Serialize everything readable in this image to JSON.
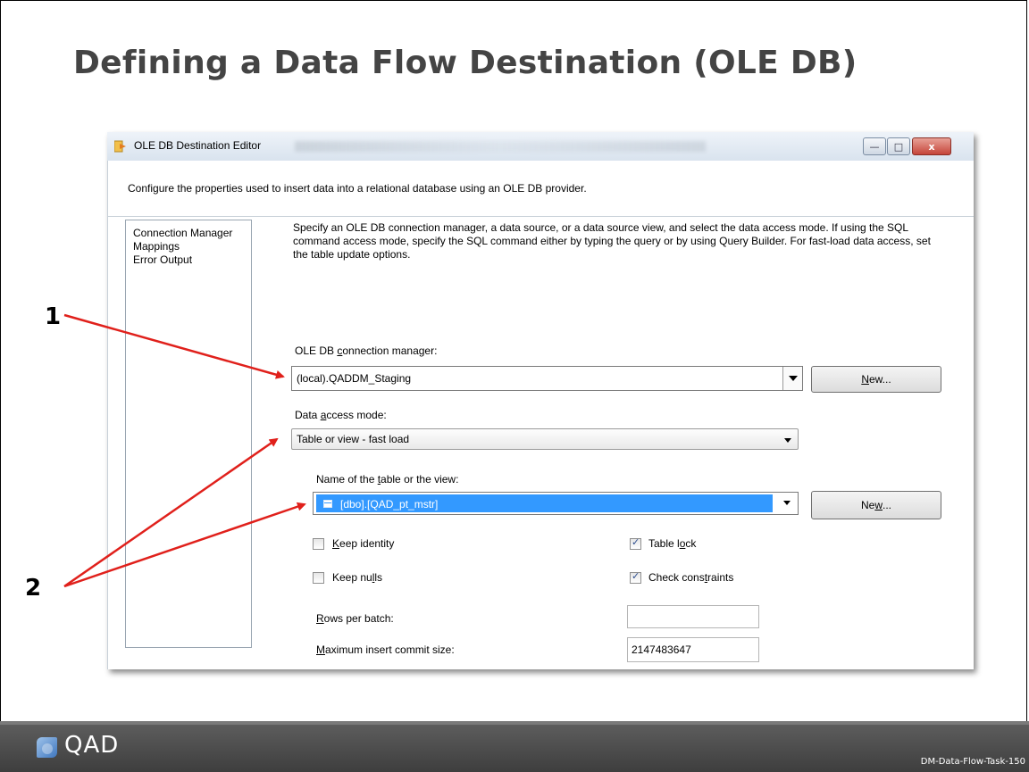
{
  "slide": {
    "title": "Defining a Data Flow Destination (OLE DB)",
    "callout_1": "1",
    "callout_2": "2",
    "footer_logo": "QAD",
    "footer_code": "DM-Data-Flow-Task-150"
  },
  "window": {
    "title": "OLE DB Destination Editor",
    "minimize_glyph": "—",
    "maximize_glyph": "□",
    "close_glyph": "x",
    "header_description": "Configure the properties used to insert data into a relational database using an OLE DB provider."
  },
  "sidebar": {
    "items": [
      {
        "label": "Connection Manager"
      },
      {
        "label": "Mappings"
      },
      {
        "label": "Error Output"
      }
    ]
  },
  "main": {
    "description": "Specify an OLE DB connection manager, a data source, or a data source view, and select the data access mode. If using the SQL command access mode, specify the SQL command either by typing the query or by using Query Builder. For fast-load data access, set the table update options.",
    "connection_manager": {
      "label_pre": "OLE DB ",
      "label_key": "c",
      "label_post": "onnection manager:",
      "value": "(local).QADDM_Staging",
      "new_pre": "",
      "new_key": "N",
      "new_post": "ew..."
    },
    "data_access_mode": {
      "label_pre": "Data ",
      "label_key": "a",
      "label_post": "ccess mode:",
      "value": "Table or view - fast load"
    },
    "table_name": {
      "label_pre": "Name of the ",
      "label_key": "t",
      "label_post": "able or the view:",
      "value": "[dbo].[QAD_pt_mstr]",
      "new_pre": "Ne",
      "new_key": "w",
      "new_post": "..."
    },
    "options": {
      "keep_identity": {
        "pre": "",
        "key": "K",
        "post": "eep identity",
        "checked": false
      },
      "keep_nulls": {
        "pre": "Keep nu",
        "key": "l",
        "post": "ls",
        "checked": false
      },
      "table_lock": {
        "pre": "Table l",
        "key": "o",
        "post": "ck",
        "checked": true
      },
      "check_constraints": {
        "pre": "Check cons",
        "key": "t",
        "post": "raints",
        "checked": true
      }
    },
    "rows_per_batch": {
      "pre": "",
      "key": "R",
      "post": "ows per batch:",
      "value": ""
    },
    "max_commit": {
      "pre": "",
      "key": "M",
      "post": "aximum insert commit size:",
      "value": "2147483647"
    }
  },
  "colors": {
    "arrow": "#e0201b",
    "selection": "#3399ff",
    "title_text": "#444444",
    "footer": "#4a4a4a"
  }
}
